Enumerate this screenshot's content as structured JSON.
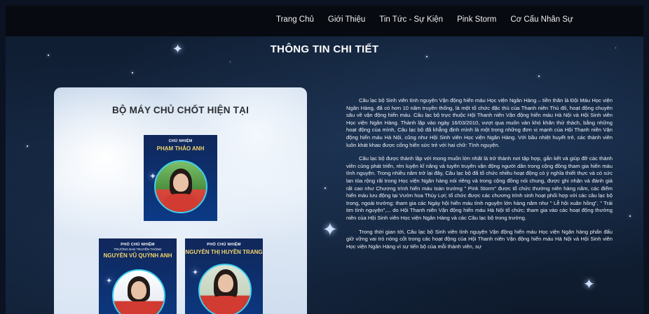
{
  "nav": {
    "items": [
      "Trang Chủ",
      "Giới Thiệu",
      "Tin Tức - Sự Kiện",
      "Pink Storm",
      "Cơ Cấu Nhân Sự"
    ]
  },
  "page": {
    "title": "THÔNG TIN CHI TIẾT"
  },
  "panel": {
    "title": "BỘ MÁY CHỦ CHỐT HIỆN TẠI",
    "members": [
      {
        "role": "CHỦ NHIỆM",
        "sub": "",
        "name": "PHẠM THẢO ANH"
      },
      {
        "role": "PHÓ CHỦ NHIỆM",
        "sub": "TRƯỞNG BAN TRUYỀN THÔNG",
        "name": "NGUYỄN VŨ QUỲNH ANH"
      },
      {
        "role": "PHÓ CHỦ NHIỆM",
        "sub": "",
        "name": "NGUYỄN THỊ HUYỀN TRANG"
      }
    ]
  },
  "article": {
    "paragraphs": [
      "Câu lạc bộ Sinh viên tình nguyện Vận động hiến máu Học viện Ngân Hàng – tiền thân là Đội Máu Học viện Ngân Hàng, đã có hơn 10 năm truyền thống, là một tổ chức đặc thù của Thanh niên Thủ đô, hoạt động chuyên sâu về vận động hiến máu. Câu lạc bộ trực thuộc Hội Thanh niên Vận động hiến máu Hà Nội và Hội Sinh viên Học viện Ngân Hàng. Thành lập vào ngày 16/03/2010, vượt qua muôn vàn khó khăn thử thách, bằng những hoạt động của mình, Câu lạc bộ đã khẳng định mình là một trong những đơn vị mạnh của Hội Thanh niên Vận động hiến máu Hà Nội, cũng như Hội Sinh viên Học viện Ngân Hàng. Với bầu nhiệt huyết trẻ, các thành viên luôn khát khao được cống hiến sức trẻ với hai chữ: Tình nguyện.",
      "Câu lạc bộ được thành lập với mong muốn lớn nhất là trở thành nơi tập hợp, gắn kết và giúp đỡ các thành viên cùng phát triển, rèn luyện kĩ năng và tuyên truyền vận động người dân trong cộng đồng tham gia hiến máu tình nguyện. Trong nhiều năm trở lại đây, Câu lạc bộ đã tổ chức nhiều hoạt động có ý nghĩa thiết thực và có sức lan tỏa rộng rãi trong Học viện Ngân hàng nói riêng và trong cộng đồng nói chung, được ghi nhận và đánh giá rất cao như Chương trình hiến máu toàn trường \" Pink Storm\" được tổ chức thường niên hàng năm, các điểm hiến máu lưu động tại Vườn hoa Thủy Lợi; tổ chức được các chương trình sinh hoạt phối hợp với các câu lạc bộ trong, ngoài trường; tham gia các Ngày hội hiến máu tình nguyện lớn hàng năm như \" Lễ hội xuân hồng\", \" Trái tim tình nguyện\",... do Hội Thanh niên Vận động hiến máu Hà Nội tổ chức; tham gia vào các hoạt động thường niên của Hội Sinh viên Học viện Ngân Hàng và các Câu lạc bộ trong trường.",
      "Trong thời gian tới, Câu lạc bộ Sinh viên tình nguyện Vận động hiến máu Học viện Ngân hàng phấn đấu giữ vững vai trò nòng cốt trong các hoạt động của Hội Thanh niên Vận động hiến máu Hà Nội và Hội Sinh viên Học viện Ngân Hàng vì sự tiến bộ của mỗi thành viên, sự"
    ]
  }
}
